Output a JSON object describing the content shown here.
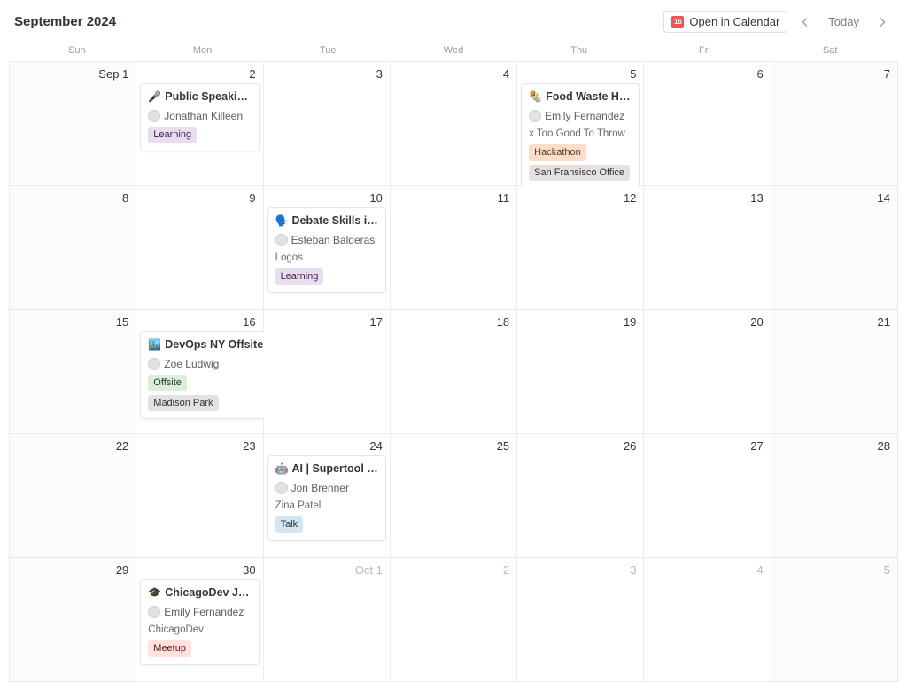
{
  "header": {
    "title": "September 2024",
    "open_in_calendar": "Open in Calendar",
    "today": "Today"
  },
  "weekdays": [
    "Sun",
    "Mon",
    "Tue",
    "Wed",
    "Thu",
    "Fri",
    "Sat"
  ],
  "days": [
    {
      "label": "Sep 1",
      "weekend": true
    },
    {
      "label": "2"
    },
    {
      "label": "3"
    },
    {
      "label": "4"
    },
    {
      "label": "5"
    },
    {
      "label": "6"
    },
    {
      "label": "7",
      "weekend": true
    },
    {
      "label": "8",
      "weekend": true
    },
    {
      "label": "9"
    },
    {
      "label": "10"
    },
    {
      "label": "11"
    },
    {
      "label": "12"
    },
    {
      "label": "13"
    },
    {
      "label": "14",
      "weekend": true
    },
    {
      "label": "15",
      "weekend": true
    },
    {
      "label": "16"
    },
    {
      "label": "17"
    },
    {
      "label": "18"
    },
    {
      "label": "19"
    },
    {
      "label": "20"
    },
    {
      "label": "21",
      "weekend": true
    },
    {
      "label": "22",
      "weekend": true
    },
    {
      "label": "23"
    },
    {
      "label": "24"
    },
    {
      "label": "25"
    },
    {
      "label": "26"
    },
    {
      "label": "27"
    },
    {
      "label": "28",
      "weekend": true
    },
    {
      "label": "29",
      "weekend": true
    },
    {
      "label": "30"
    },
    {
      "label": "Oct 1",
      "other": true
    },
    {
      "label": "2",
      "other": true
    },
    {
      "label": "3",
      "other": true
    },
    {
      "label": "4",
      "other": true
    },
    {
      "label": "5",
      "other": true,
      "weekend": true
    }
  ],
  "events": {
    "public_speaking": {
      "emoji": "🎤",
      "title": "Public Speaking f…",
      "person": "Jonathan Killeen",
      "tag": "Learning"
    },
    "food_waste": {
      "emoji": "🌯",
      "title": "Food Waste Hack…",
      "person": "Emily Fernandez",
      "meta": "x Too Good To Throw",
      "tag1": "Hackathon",
      "tag2": "San Fransisco Office"
    },
    "debate": {
      "emoji": "🗣️",
      "title": "Debate Skills in th…",
      "person": "Esteban Balderas",
      "meta": "Logos",
      "tag": "Learning"
    },
    "devops": {
      "emoji": "🏙️",
      "title": "DevOps NY Offsite",
      "person": "Zoe Ludwig",
      "tag1": "Offsite",
      "tag2": "Madison Park"
    },
    "ai_talk": {
      "emoji": "🤖",
      "title": "AI | Supertool or s…",
      "person": "Jon Brenner",
      "meta": "Zina Patel",
      "tag": "Talk"
    },
    "chicago": {
      "emoji": "🎓",
      "title": "ChicagoDev June …",
      "person": "Emily Fernandez",
      "meta": "ChicagoDev",
      "tag": "Meetup"
    }
  }
}
